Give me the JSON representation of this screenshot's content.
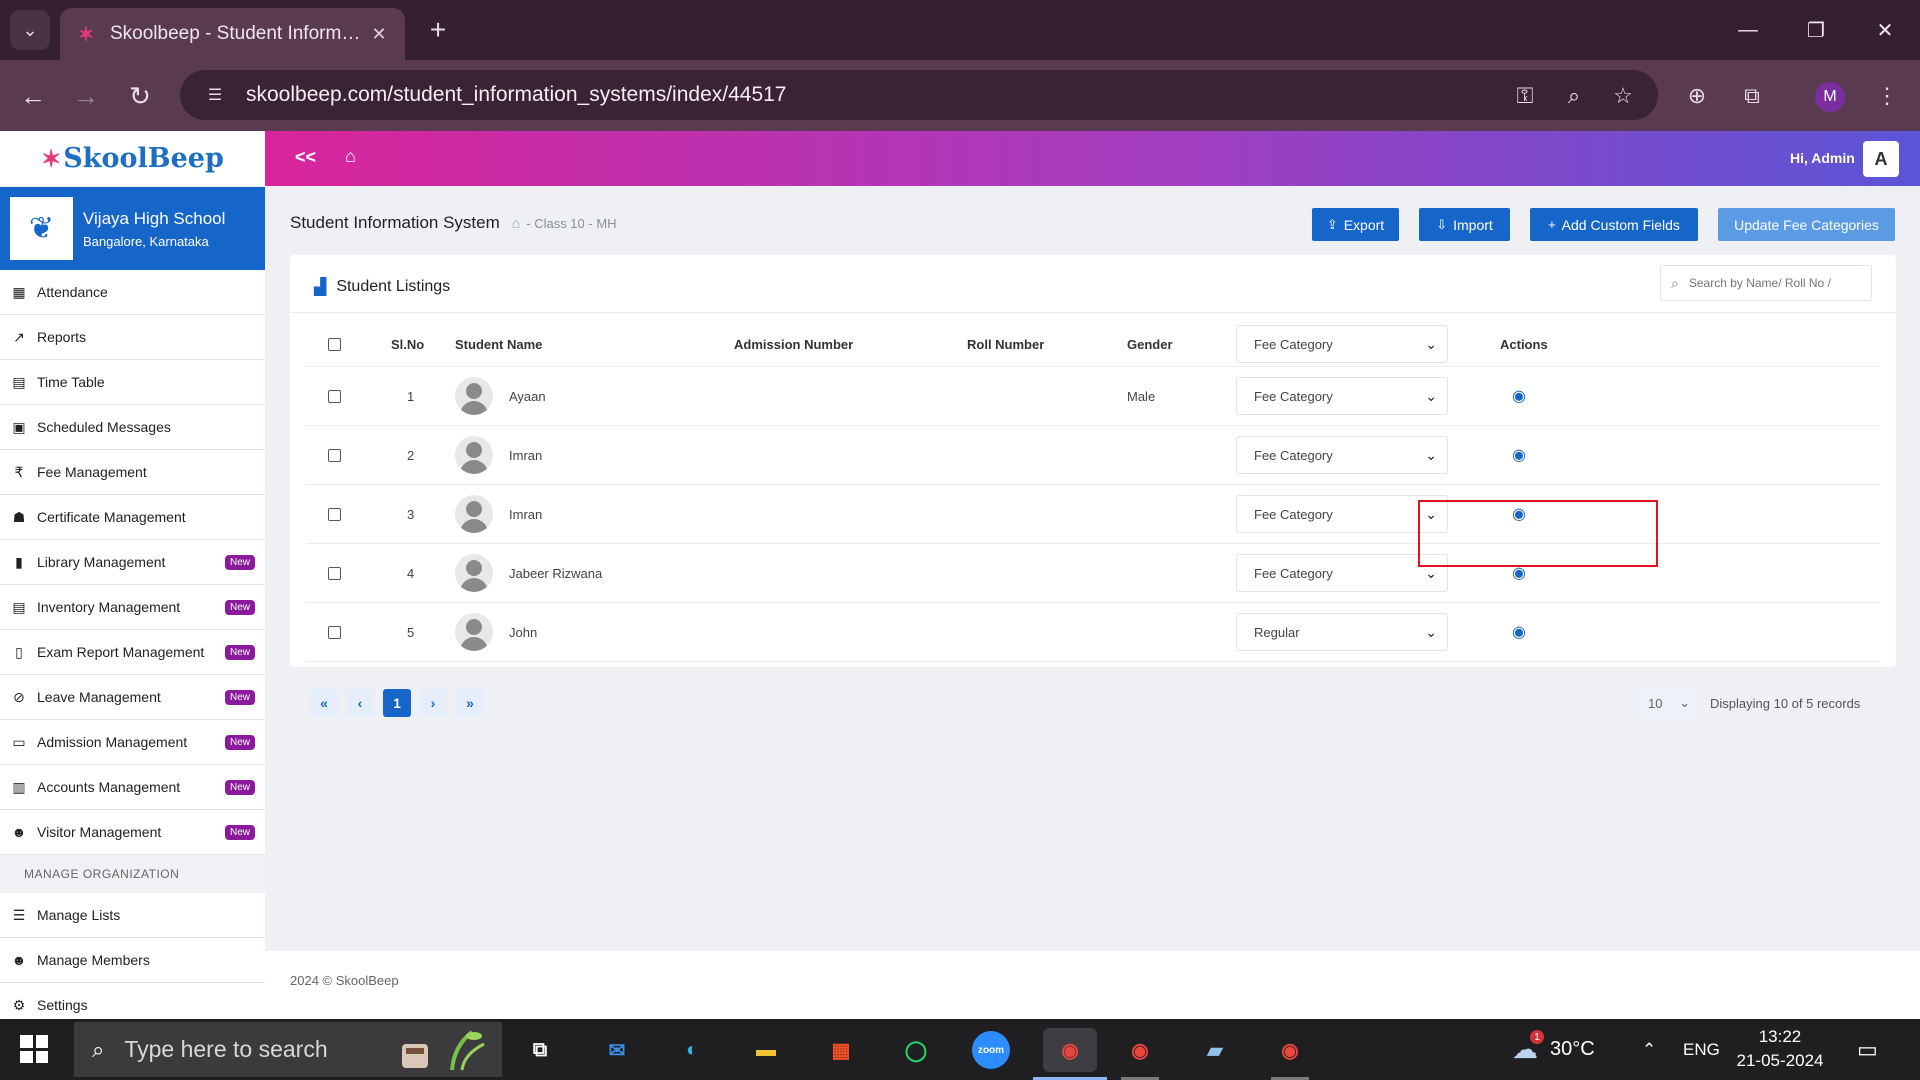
{
  "browser": {
    "tab_title": "Skoolbeep - Student Informatio",
    "url": "skoolbeep.com/student_information_systems/index/44517",
    "profile_initial": "M"
  },
  "sidebar": {
    "logo_text": "SkoolBeep",
    "school_name": "Vijaya High School",
    "school_location": "Bangalore, Karnataka",
    "items": [
      {
        "label": "Attendance",
        "icon": "calendar-icon",
        "badge": ""
      },
      {
        "label": "Reports",
        "icon": "chart-icon",
        "badge": ""
      },
      {
        "label": "Time Table",
        "icon": "timetable-icon",
        "badge": ""
      },
      {
        "label": "Scheduled Messages",
        "icon": "calendar-check-icon",
        "badge": ""
      },
      {
        "label": "Fee Management",
        "icon": "rupee-icon",
        "badge": ""
      },
      {
        "label": "Certificate Management",
        "icon": "certificate-icon",
        "badge": ""
      },
      {
        "label": "Library Management",
        "icon": "book-icon",
        "badge": "New"
      },
      {
        "label": "Inventory Management",
        "icon": "list-icon",
        "badge": "New"
      },
      {
        "label": "Exam Report Management",
        "icon": "document-icon",
        "badge": "New"
      },
      {
        "label": "Leave Management",
        "icon": "user-slash-icon",
        "badge": "New"
      },
      {
        "label": "Admission Management",
        "icon": "id-card-icon",
        "badge": "New"
      },
      {
        "label": "Accounts Management",
        "icon": "ledger-icon",
        "badge": "New"
      },
      {
        "label": "Visitor Management",
        "icon": "users-icon",
        "badge": "New"
      }
    ],
    "section_label": "MANAGE ORGANIZATION",
    "org_items": [
      {
        "label": "Manage Lists",
        "icon": "list-icon"
      },
      {
        "label": "Manage Members",
        "icon": "users-icon"
      },
      {
        "label": "Settings",
        "icon": "gear-icon"
      }
    ]
  },
  "topbar": {
    "collapse_label": "<<",
    "greeting": "Hi, Admin",
    "avatar_initial": "A"
  },
  "page": {
    "title": "Student Information System",
    "breadcrumb": "- Class 10 - MH",
    "buttons": {
      "export": "Export",
      "import": "Import",
      "add_custom_fields": "Add Custom Fields",
      "update_fee_categories": "Update Fee Categories"
    }
  },
  "listing": {
    "title": "Student Listings",
    "search_placeholder": "Search by Name/ Roll No /",
    "columns": {
      "sl_no": "Sl.No",
      "student_name": "Student Name",
      "admission_number": "Admission Number",
      "roll_number": "Roll Number",
      "gender": "Gender",
      "fee_category": "Fee Category",
      "actions": "Actions"
    },
    "rows": [
      {
        "sl": "1",
        "name": "Ayaan",
        "admission": "",
        "roll": "",
        "gender": "Male",
        "fee_category": "Fee Category"
      },
      {
        "sl": "2",
        "name": "Imran",
        "admission": "",
        "roll": "",
        "gender": "",
        "fee_category": "Fee Category"
      },
      {
        "sl": "3",
        "name": "Imran",
        "admission": "",
        "roll": "",
        "gender": "",
        "fee_category": "Fee Category"
      },
      {
        "sl": "4",
        "name": "Jabeer Rizwana",
        "admission": "",
        "roll": "",
        "gender": "",
        "fee_category": "Fee Category"
      },
      {
        "sl": "5",
        "name": "John",
        "admission": "",
        "roll": "",
        "gender": "",
        "fee_category": "Regular"
      }
    ],
    "pagination": {
      "first": "«",
      "prev": "‹",
      "current_page": "1",
      "next": "›",
      "last": "»",
      "per_page": "10",
      "records_text": "Displaying 10 of 5 records"
    }
  },
  "footer": {
    "text": "2024 © SkoolBeep"
  },
  "taskbar": {
    "search_placeholder": "Type here to search",
    "weather_temp": "30°C",
    "weather_badge": "1",
    "language": "ENG",
    "time": "13:22",
    "date": "21-05-2024",
    "zoom_label": "zoom"
  },
  "colors": {
    "brand_blue": "#1665c8",
    "gradient_start": "#d9259b",
    "gradient_end": "#5a55d6",
    "highlight_red": "#e0141e",
    "new_badge": "#8b1a9c"
  }
}
